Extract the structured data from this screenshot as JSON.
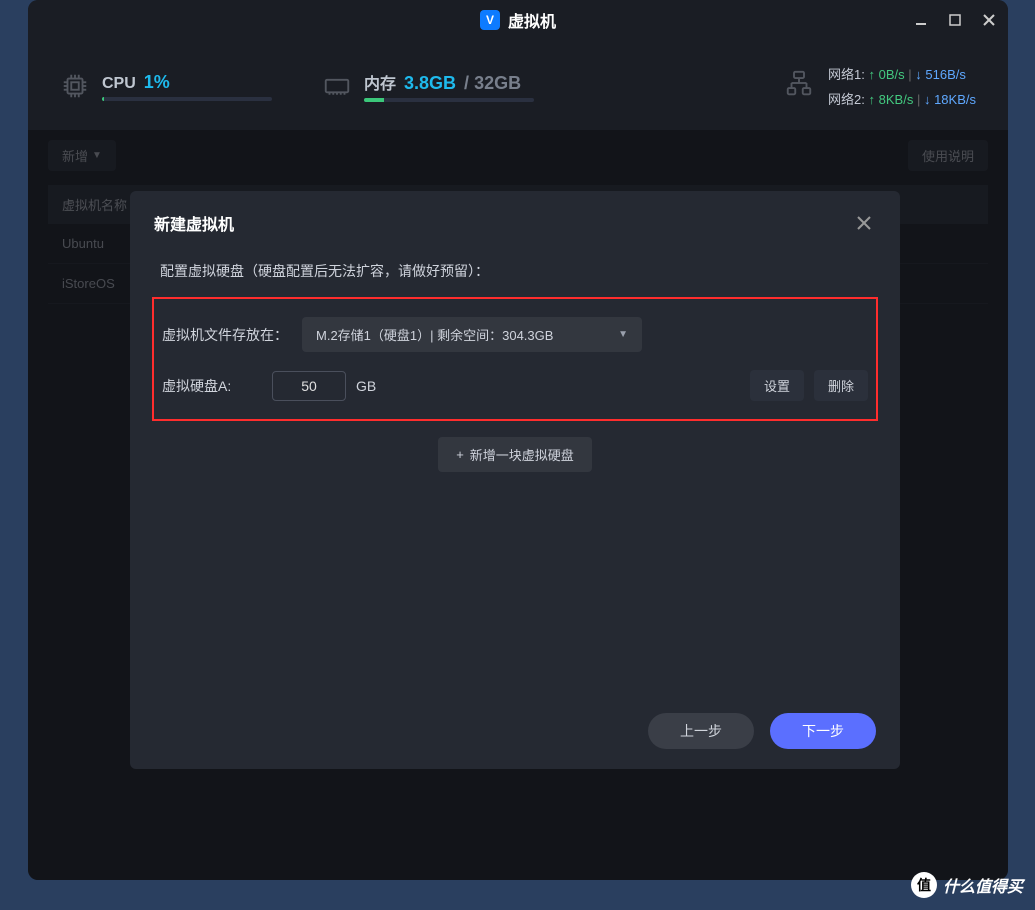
{
  "titlebar": {
    "title": "虚拟机",
    "icon_letter": "V"
  },
  "stats": {
    "cpu": {
      "label": "CPU",
      "value": "1%",
      "bar_pct": 1
    },
    "mem": {
      "label": "内存",
      "used": "3.8GB",
      "total": "32GB",
      "bar_pct": 12
    },
    "net1": {
      "label": "网络1:",
      "up": "0B/s",
      "down": "516B/s"
    },
    "net2": {
      "label": "网络2:",
      "up": "8KB/s",
      "down": "18KB/s"
    }
  },
  "toolbar": {
    "add_label": "新增",
    "help_label": "使用说明"
  },
  "table": {
    "header_name": "虚拟机名称",
    "rows": [
      "Ubuntu",
      "iStoreOS"
    ]
  },
  "dialog": {
    "title": "新建虚拟机",
    "desc": "配置虚拟硬盘（硬盘配置后无法扩容，请做好预留）：",
    "storage_label": "虚拟机文件存放在：",
    "storage_value": "M.2存储1（硬盘1）| 剩余空间：304.3GB",
    "disk_a_label": "虚拟硬盘A:",
    "disk_a_value": "50",
    "disk_unit": "GB",
    "settings_btn": "设置",
    "delete_btn": "删除",
    "add_disk_btn": "新增一块虚拟硬盘",
    "prev_btn": "上一步",
    "next_btn": "下一步"
  },
  "watermark": {
    "icon": "值",
    "text": "什么值得买"
  }
}
